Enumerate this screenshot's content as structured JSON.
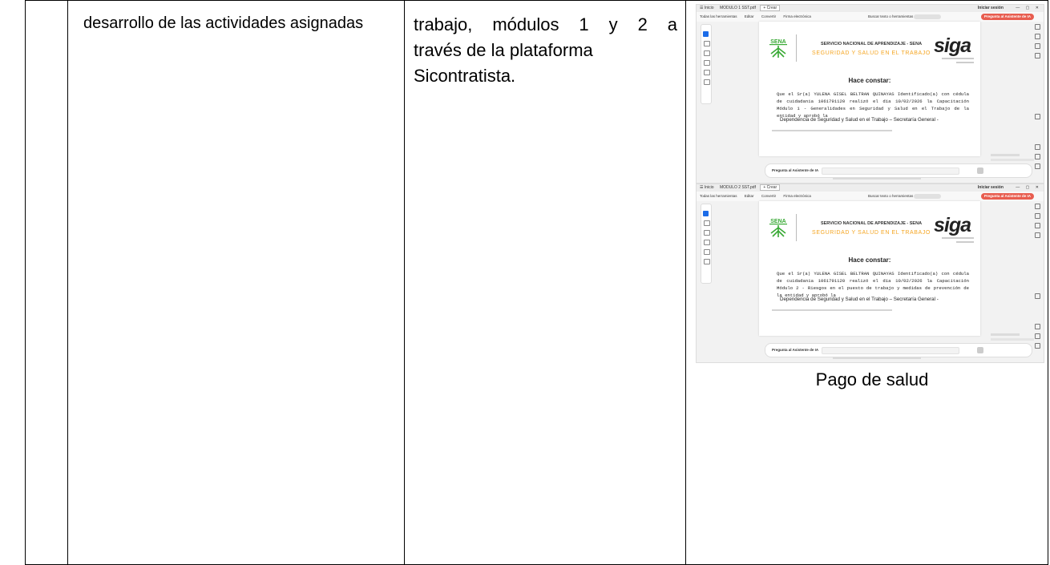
{
  "cells": {
    "col2_text": "desarrollo de las actividades asignadas",
    "col3_line1": "trabajo, módulos 1 y 2 a",
    "col3_line2": "través de la plataforma",
    "col3_line3": "Sicontratista."
  },
  "screenshots": [
    {
      "tab_home": "Inicio",
      "tab_title": "MODULO 1 SST.pdf",
      "tab_new": "+ Crear",
      "signin": "Iniciar sesión",
      "menu_all_tools": "Todas las herramientas",
      "menu_edit": "Editar",
      "menu_convert": "Convertir",
      "menu_sign": "Firma electrónica",
      "search_label": "Buscar texto o herramientas",
      "ai_button": "Pregunta al Asistente de IA",
      "sena_logo_text": "SENA",
      "header_line1": "SERVICIO NACIONAL DE APRENDIZAJE - SENA",
      "header_line2": "SEGURIDAD Y SALUD EN EL TRABAJO",
      "siga_logo": "siga",
      "hace_constar": "Hace constar:",
      "body_text": "Que el Sr(a) YULENA GISEL BELTRAN QUINAYAS Identificado(a) con cédula de cuidadania 1061791120 realizó el día 10/02/2026 la Capacitación Módulo 1 - Generalidades en Seguridad y Salud en el Trabajo de la entidad y aprobó la",
      "dependencia": "Dependencia de Seguridad y Salud en el Trabajo – Secretaría General -",
      "ask_label": "Pregunta al Asistente de IA"
    },
    {
      "tab_home": "Inicio",
      "tab_title": "MODULO 2 SST.pdf",
      "tab_new": "+ Crear",
      "signin": "Iniciar sesión",
      "menu_all_tools": "Todas las herramientas",
      "menu_edit": "Editar",
      "menu_convert": "Convertir",
      "menu_sign": "Firma electrónica",
      "search_label": "Buscar texto o herramientas",
      "ai_button": "Pregunta al Asistente de IA",
      "sena_logo_text": "SENA",
      "header_line1": "SERVICIO NACIONAL DE APRENDIZAJE - SENA",
      "header_line2": "SEGURIDAD Y SALUD EN EL TRABAJO",
      "siga_logo": "siga",
      "hace_constar": "Hace constar:",
      "body_text": "Que el Sr(a) YULENA GISEL BELTRAN QUINAYAS Identificado(a) con cédula de cuidadania 1061791120 realizó el día 10/02/2026 la Capacitación Módulo 2 - Riesgos en el puesto de trabajo y medidas de prevención de la entidad y aprobó la",
      "dependencia": "Dependencia de Seguridad y Salud en el Trabajo – Secretaría General -",
      "ask_label": "Pregunta al Asistente de IA"
    }
  ],
  "caption": "Pago de salud",
  "colors": {
    "accent_ai": "#e85d4f",
    "sena_green": "#39a935",
    "sst_orange": "#f5a623",
    "selected_tool": "#1b6ce8"
  }
}
